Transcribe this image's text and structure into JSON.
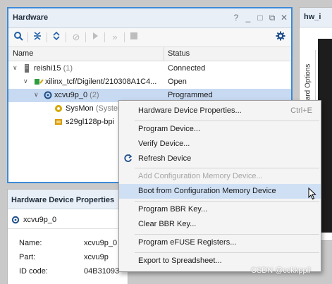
{
  "hardware_panel": {
    "title": "Hardware",
    "controls": {
      "help": "?",
      "minimize": "_",
      "restore": "□",
      "float": "⧉",
      "close": "✕"
    },
    "columns": {
      "name": "Name",
      "status": "Status"
    },
    "rows": [
      {
        "label": "reishi15",
        "count": "(1)",
        "status": "Connected"
      },
      {
        "label": "xilinx_tcf/Digilent/210308A1C4...",
        "status": "Open"
      },
      {
        "label": "xcvu9p_0",
        "count": "(2)",
        "status": "Programmed"
      },
      {
        "label": "SysMon",
        "count": "(System"
      },
      {
        "label": "s29gl128p-bpi"
      }
    ]
  },
  "right_panel": {
    "title": "hw_i",
    "vertical_tab": "Board Options"
  },
  "properties_panel": {
    "title": "Hardware Device Properties",
    "device": "xcvu9p_0",
    "fields": [
      {
        "key": "Name:",
        "value": "xcvu9p_0"
      },
      {
        "key": "Part:",
        "value": "xcvu9p"
      },
      {
        "key": "ID code:",
        "value": "04B31093"
      }
    ]
  },
  "context_menu": {
    "items": [
      {
        "label": "Hardware Device Properties...",
        "shortcut": "Ctrl+E"
      },
      {
        "label": "Program Device..."
      },
      {
        "label": "Verify Device..."
      },
      {
        "label": "Refresh Device"
      },
      {
        "label": "Add Configuration Memory Device..."
      },
      {
        "label": "Boot from Configuration Memory Device"
      },
      {
        "label": "Program BBR Key..."
      },
      {
        "label": "Clear BBR Key..."
      },
      {
        "label": "Program eFUSE Registers..."
      },
      {
        "label": "Export to Spreadsheet..."
      }
    ]
  },
  "watermark": "CSDN @cckkppll",
  "colors": {
    "selection": "#c8daf2",
    "menu_hover": "#cfe0f5",
    "panel_border_active": "#3c8ad8"
  }
}
